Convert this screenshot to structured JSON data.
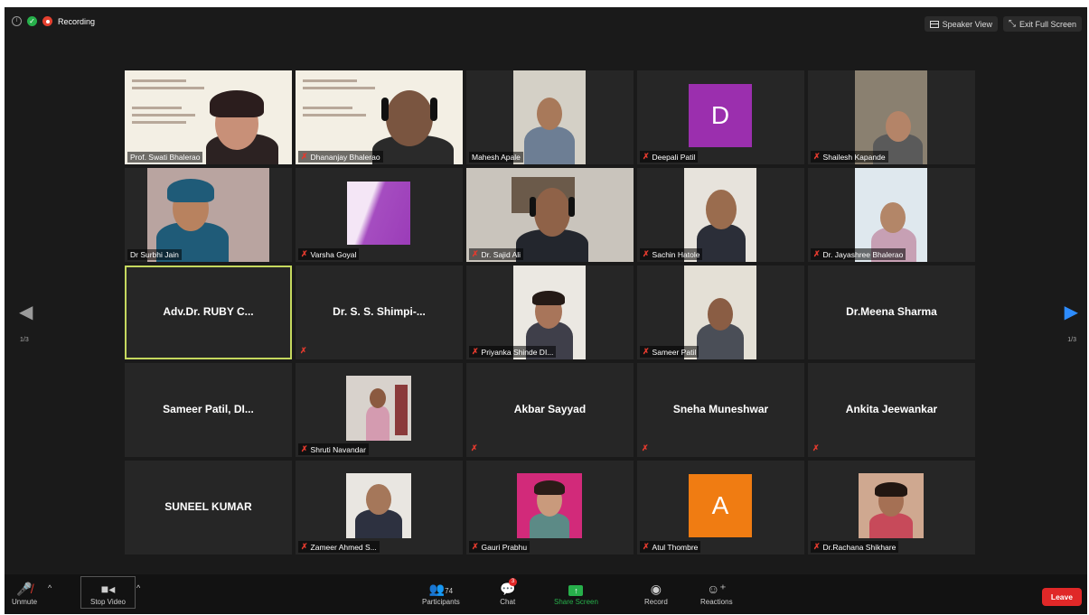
{
  "topbar": {
    "recording_label": "Recording",
    "speaker_view_label": "Speaker View",
    "exit_fullscreen_label": "Exit Full Screen"
  },
  "pagination": {
    "left": "1/3",
    "right": "1/3"
  },
  "participants": [
    {
      "name": "Prof. Swati Bhalerao",
      "video": true
    },
    {
      "name": "Dhananjay Bhalerao",
      "video": true
    },
    {
      "name": "Mahesh Apale",
      "video": true
    },
    {
      "name": "Deepali Patil",
      "video": true,
      "letter": "D"
    },
    {
      "name": "Shailesh Kapande",
      "video": true
    },
    {
      "name": "Dr Surbhi Jain",
      "video": true
    },
    {
      "name": "Varsha Goyal",
      "video": true
    },
    {
      "name": "Dr. Sajid Ali",
      "video": true
    },
    {
      "name": "Sachin Hatole",
      "video": true
    },
    {
      "name": "Dr. Jayashree Bhalerao",
      "video": true
    },
    {
      "name": "Adv.Dr. RUBY C...",
      "video": false
    },
    {
      "name": "Dr. S. S. Shimpi-...",
      "video": false
    },
    {
      "name": "Priyanka Shinde DI...",
      "video": true
    },
    {
      "name": "Sameer Patil",
      "video": true
    },
    {
      "name": "Dr.Meena Sharma",
      "video": false
    },
    {
      "name": "Sameer Patil, DI...",
      "video": false
    },
    {
      "name": "Shruti Navandar",
      "video": true
    },
    {
      "name": "Akbar Sayyad",
      "video": false
    },
    {
      "name": "Sneha Muneshwar",
      "video": false
    },
    {
      "name": "Ankita Jeewankar",
      "video": false
    },
    {
      "name": "SUNEEL KUMAR",
      "video": false
    },
    {
      "name": "Zameer Ahmed S...",
      "video": true
    },
    {
      "name": "Gauri Prabhu",
      "video": true
    },
    {
      "name": "Atul Thombre",
      "video": true,
      "letter": "A"
    },
    {
      "name": "Dr.Rachana Shikhare",
      "video": true
    }
  ],
  "toolbar": {
    "unmute_label": "Unmute",
    "stop_video_label": "Stop Video",
    "participants_label": "Participants",
    "participants_count": "74",
    "chat_label": "Chat",
    "chat_badge": "3",
    "share_screen_label": "Share Screen",
    "record_label": "Record",
    "reactions_label": "Reactions",
    "leave_label": "Leave"
  },
  "colors": {
    "background": "#1a1a1a",
    "tile": "#262626",
    "active_speaker_border": "#c5d85e",
    "mute_red": "#e23a2e",
    "share_green": "#27b04b",
    "leave_red": "#e02828",
    "letter_purple": "#9b2fae",
    "letter_orange": "#f07c12"
  },
  "icons": [
    "info-icon",
    "shield-icon",
    "recording-icon",
    "speaker-view-icon",
    "exit-fullscreen-icon",
    "mic-muted-icon",
    "video-camera-icon",
    "participants-icon",
    "chat-icon",
    "share-screen-icon",
    "record-icon",
    "reactions-icon",
    "arrow-left-icon",
    "arrow-right-icon"
  ]
}
